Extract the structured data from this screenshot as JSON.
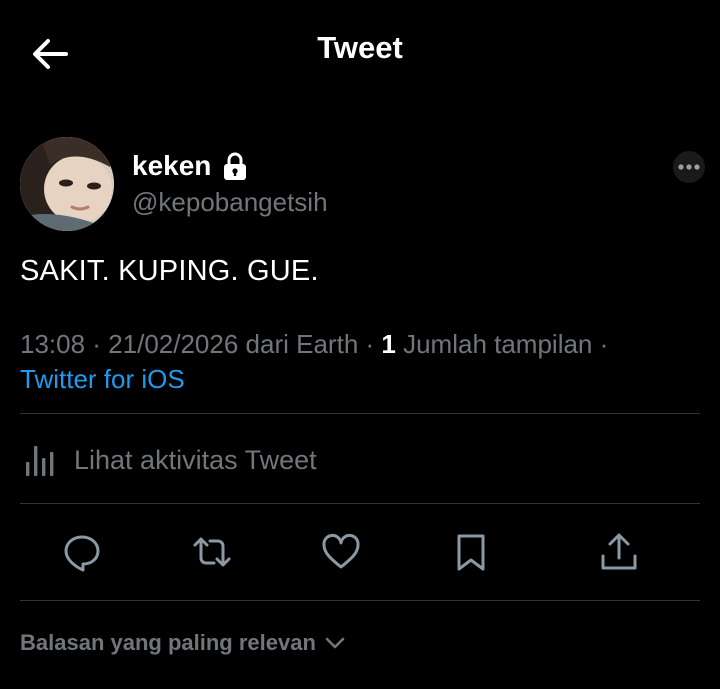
{
  "header": {
    "title": "Tweet"
  },
  "author": {
    "display_name": "keken",
    "handle": "@kepobangetsih"
  },
  "tweet": {
    "text": "SAKIT. KUPING. GUE.",
    "time": "13:08",
    "sep1": " · ",
    "date": "21/02/2026",
    "location": " dari Earth",
    "sep2": " · ",
    "views_count": "1",
    "views_label": " Jumlah tampilan",
    "sep3": " ·",
    "client": "Twitter for iOS"
  },
  "activity": {
    "label": "Lihat aktivitas Tweet"
  },
  "replies": {
    "sort_label": "Balasan yang paling relevan"
  },
  "colors": {
    "background": "#000000",
    "text": "#e7e9ea",
    "muted": "#71767b",
    "accent": "#1d9bf0",
    "divider": "#2f3336"
  },
  "icons": [
    "back-arrow-icon",
    "lock-icon",
    "more-icon",
    "analytics-icon",
    "reply-icon",
    "retweet-icon",
    "like-icon",
    "bookmark-icon",
    "share-icon",
    "chevron-down-icon"
  ]
}
